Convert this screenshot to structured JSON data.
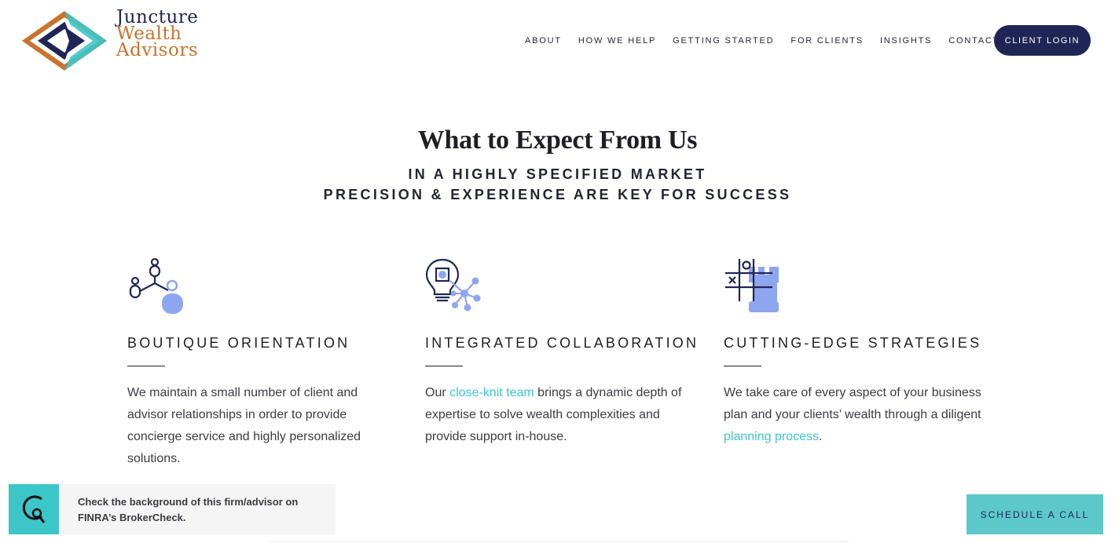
{
  "brand": {
    "logo_lines": [
      "Juncture",
      "Wealth",
      "Advisors"
    ],
    "colors": {
      "navy": "#1f2656",
      "copper": "#c8742c",
      "teal": "#3cc6c8",
      "lavender": "#8ea6f0"
    }
  },
  "nav": {
    "items": [
      "ABOUT",
      "HOW WE HELP",
      "GETTING STARTED",
      "FOR CLIENTS",
      "INSIGHTS",
      "CONTACT"
    ],
    "login_label": "CLIENT LOGIN"
  },
  "section": {
    "title": "What to Expect From Us",
    "subtitle_line1": "IN A HIGHLY SPECIFIED MARKET",
    "subtitle_line2": "PRECISION & EXPERIENCE ARE KEY FOR SUCCESS"
  },
  "features": [
    {
      "icon": "people-network-icon",
      "title": "BOUTIQUE ORIENTATION",
      "text": "We maintain a small number of client and advisor relationships in order to provide concierge service and highly personalized solutions."
    },
    {
      "icon": "lightbulb-network-icon",
      "title": "INTEGRATED COLLABORATION",
      "text_before": "Our ",
      "link": "close-knit team",
      "text_after": " brings a dynamic depth of expertise to solve wealth complexities and provide support in-house."
    },
    {
      "icon": "tictactoe-chess-rook-icon",
      "title": "CUTTING-EDGE STRATEGIES",
      "text_before": "We take care of every aspect of your business plan and your clients’ wealth through a diligent ",
      "link": "planning process",
      "text_after": "."
    }
  ],
  "brokercheck": {
    "icon": "brokercheck-magnifier-icon",
    "line1": "Check the background of this firm/advisor on",
    "line2": "FINRA’s BrokerCheck."
  },
  "schedule_label": "SCHEDULE A CALL"
}
